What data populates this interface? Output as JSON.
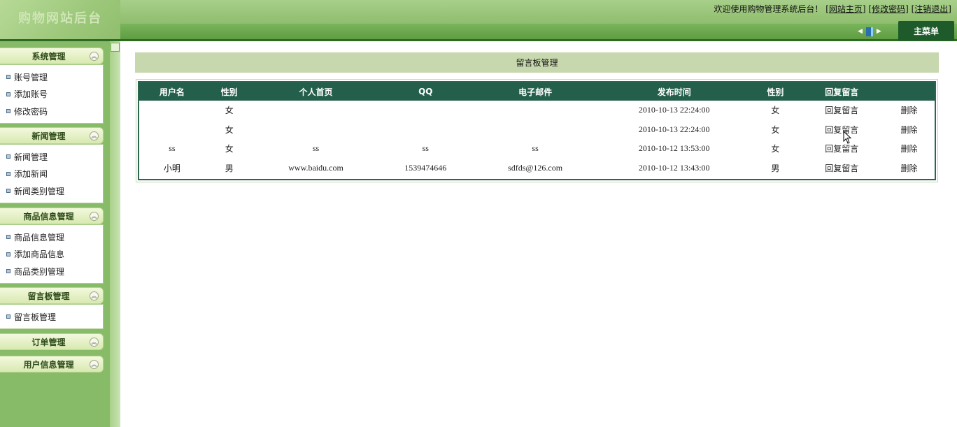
{
  "header": {
    "logo_text": "购物网站后台",
    "welcome_text": "欢迎使用购物管理系统后台！",
    "links": [
      "[网站主页]",
      "[修改密码]",
      "[注销退出]"
    ],
    "main_menu_label": "主菜单",
    "colors": {
      "header": "#8fbd6d",
      "bar": "#5f9d42",
      "tab": "#1e5a2a"
    }
  },
  "sidebar": {
    "groups": [
      {
        "title": "系统管理",
        "items": [
          "账号管理",
          "添加账号",
          "修改密码"
        ]
      },
      {
        "title": "新闻管理",
        "items": [
          "新闻管理",
          "添加新闻",
          "新闻类别管理"
        ]
      },
      {
        "title": "商品信息管理",
        "items": [
          "商品信息管理",
          "添加商品信息",
          "商品类别管理"
        ]
      },
      {
        "title": "留言板管理",
        "items": [
          "留言板管理"
        ]
      },
      {
        "title": "订单管理",
        "items": []
      },
      {
        "title": "用户信息管理",
        "items": []
      }
    ]
  },
  "main": {
    "page_title": "留言板管理",
    "table": {
      "headers": [
        "用户名",
        "性别",
        "个人首页",
        "QQ",
        "电子邮件",
        "发布时间",
        "性别",
        "回复留言",
        ""
      ],
      "rows": [
        {
          "username": "",
          "gender": "女",
          "homepage": "",
          "qq": "",
          "email": "",
          "time": "2010-10-13 22:24:00",
          "gender2": "女",
          "reply": "回复留言",
          "delete": "删除"
        },
        {
          "username": "",
          "gender": "女",
          "homepage": "",
          "qq": "",
          "email": "",
          "time": "2010-10-13 22:24:00",
          "gender2": "女",
          "reply": "回复留言",
          "delete": "删除"
        },
        {
          "username": "ss",
          "gender": "女",
          "homepage": "ss",
          "qq": "ss",
          "email": "ss",
          "time": "2010-10-12 13:53:00",
          "gender2": "女",
          "reply": "回复留言",
          "delete": "删除"
        },
        {
          "username": "小明",
          "gender": "男",
          "homepage": "www.baidu.com",
          "qq": "1539474646",
          "email": "sdfds@126.com",
          "time": "2010-10-12 13:43:00",
          "gender2": "男",
          "reply": "回复留言",
          "delete": "删除"
        }
      ]
    }
  }
}
